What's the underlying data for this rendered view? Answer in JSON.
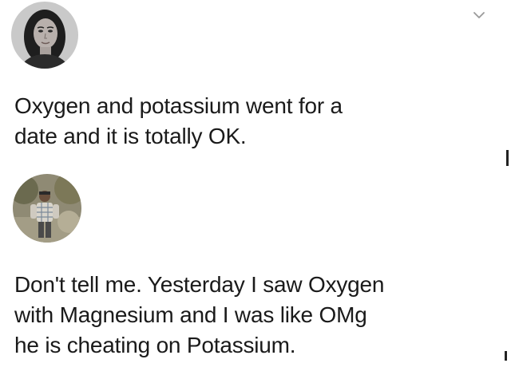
{
  "posts": [
    {
      "author_avatar": "woman-portrait-avatar",
      "text": "Oxygen and potassium went for a\ndate and it is totally OK."
    },
    {
      "author_avatar": "man-outdoors-avatar",
      "text": "Don't tell me. Yesterday I saw Oxygen\nwith Magnesium and I was like OMg\nhe is cheating on Potassium."
    }
  ],
  "icons": {
    "menu": "chevron-down-icon"
  }
}
